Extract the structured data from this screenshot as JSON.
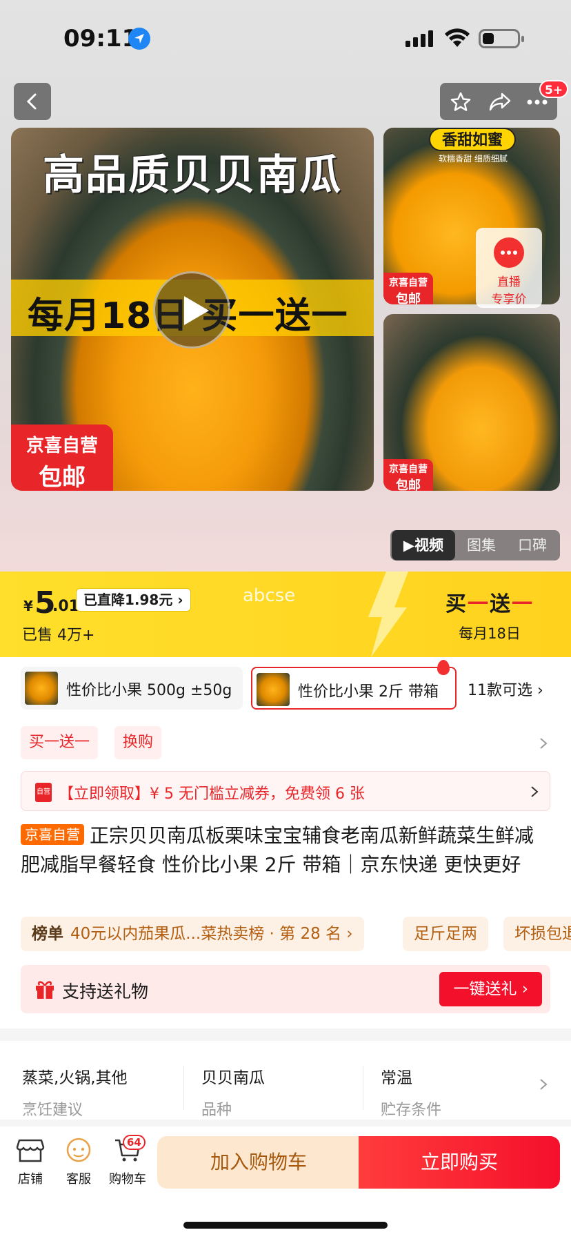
{
  "status_bar": {
    "time": "09:11"
  },
  "nav": {
    "badge": "5+"
  },
  "gallery": {
    "main_title": "高品质贝贝南瓜",
    "main_band": "每月18日 买一送一",
    "main_tag_line1": "京喜自营",
    "main_tag_line2": "包邮",
    "side1_banner": "香甜如蜜",
    "side1_sub": "软糯香甜 细质细腻",
    "side_tag_line1": "京喜自营",
    "side_tag_line2": "包邮",
    "live_line1": "直播",
    "live_line2": "专享价",
    "tabs": [
      "视频",
      "图集",
      "口碑"
    ]
  },
  "price": {
    "currency": "¥",
    "integer": "5",
    "decimal": ".01",
    "drop_label": "已直降1.98元",
    "sold": "已售 4万+",
    "watermark": "abcse",
    "promo_main": "买一送一",
    "promo_date": "每月18日"
  },
  "variants": {
    "items": [
      "性价比小果 500g ±50g",
      "性价比小果 2斤 带箱"
    ],
    "selected_index": 1,
    "more_label": "11款可选"
  },
  "chips": [
    "买一送一",
    "换购"
  ],
  "coupon": {
    "text": "【立即领取】¥ 5 无门槛立减券，免费领 6 张",
    "icon_label": "自营"
  },
  "product": {
    "owner_tag": "京喜自营",
    "title": "正宗贝贝南瓜板栗味宝宝辅食老南瓜新鲜蔬菜生鲜减肥减脂早餐轻食 性价比小果 2斤 带箱｜京东快递 更快更好"
  },
  "rank": {
    "label": "榜单",
    "text": "40元以内茄果瓜...菜热卖榜 · 第 28 名",
    "badge2": "足斤足两",
    "badge3": "坏损包退"
  },
  "gift": {
    "text": "支持送礼物",
    "button": "一键送礼"
  },
  "specs": [
    {
      "value": "蒸菜,火锅,其他",
      "key": "烹饪建议"
    },
    {
      "value": "贝贝南瓜",
      "key": "品种"
    },
    {
      "value": "常温",
      "key": "贮存条件"
    }
  ],
  "bottom_bar": {
    "shop": "店铺",
    "service": "客服",
    "cart": "购物车",
    "cart_count": "64",
    "add_to_cart": "加入购物车",
    "buy_now": "立即购买"
  }
}
